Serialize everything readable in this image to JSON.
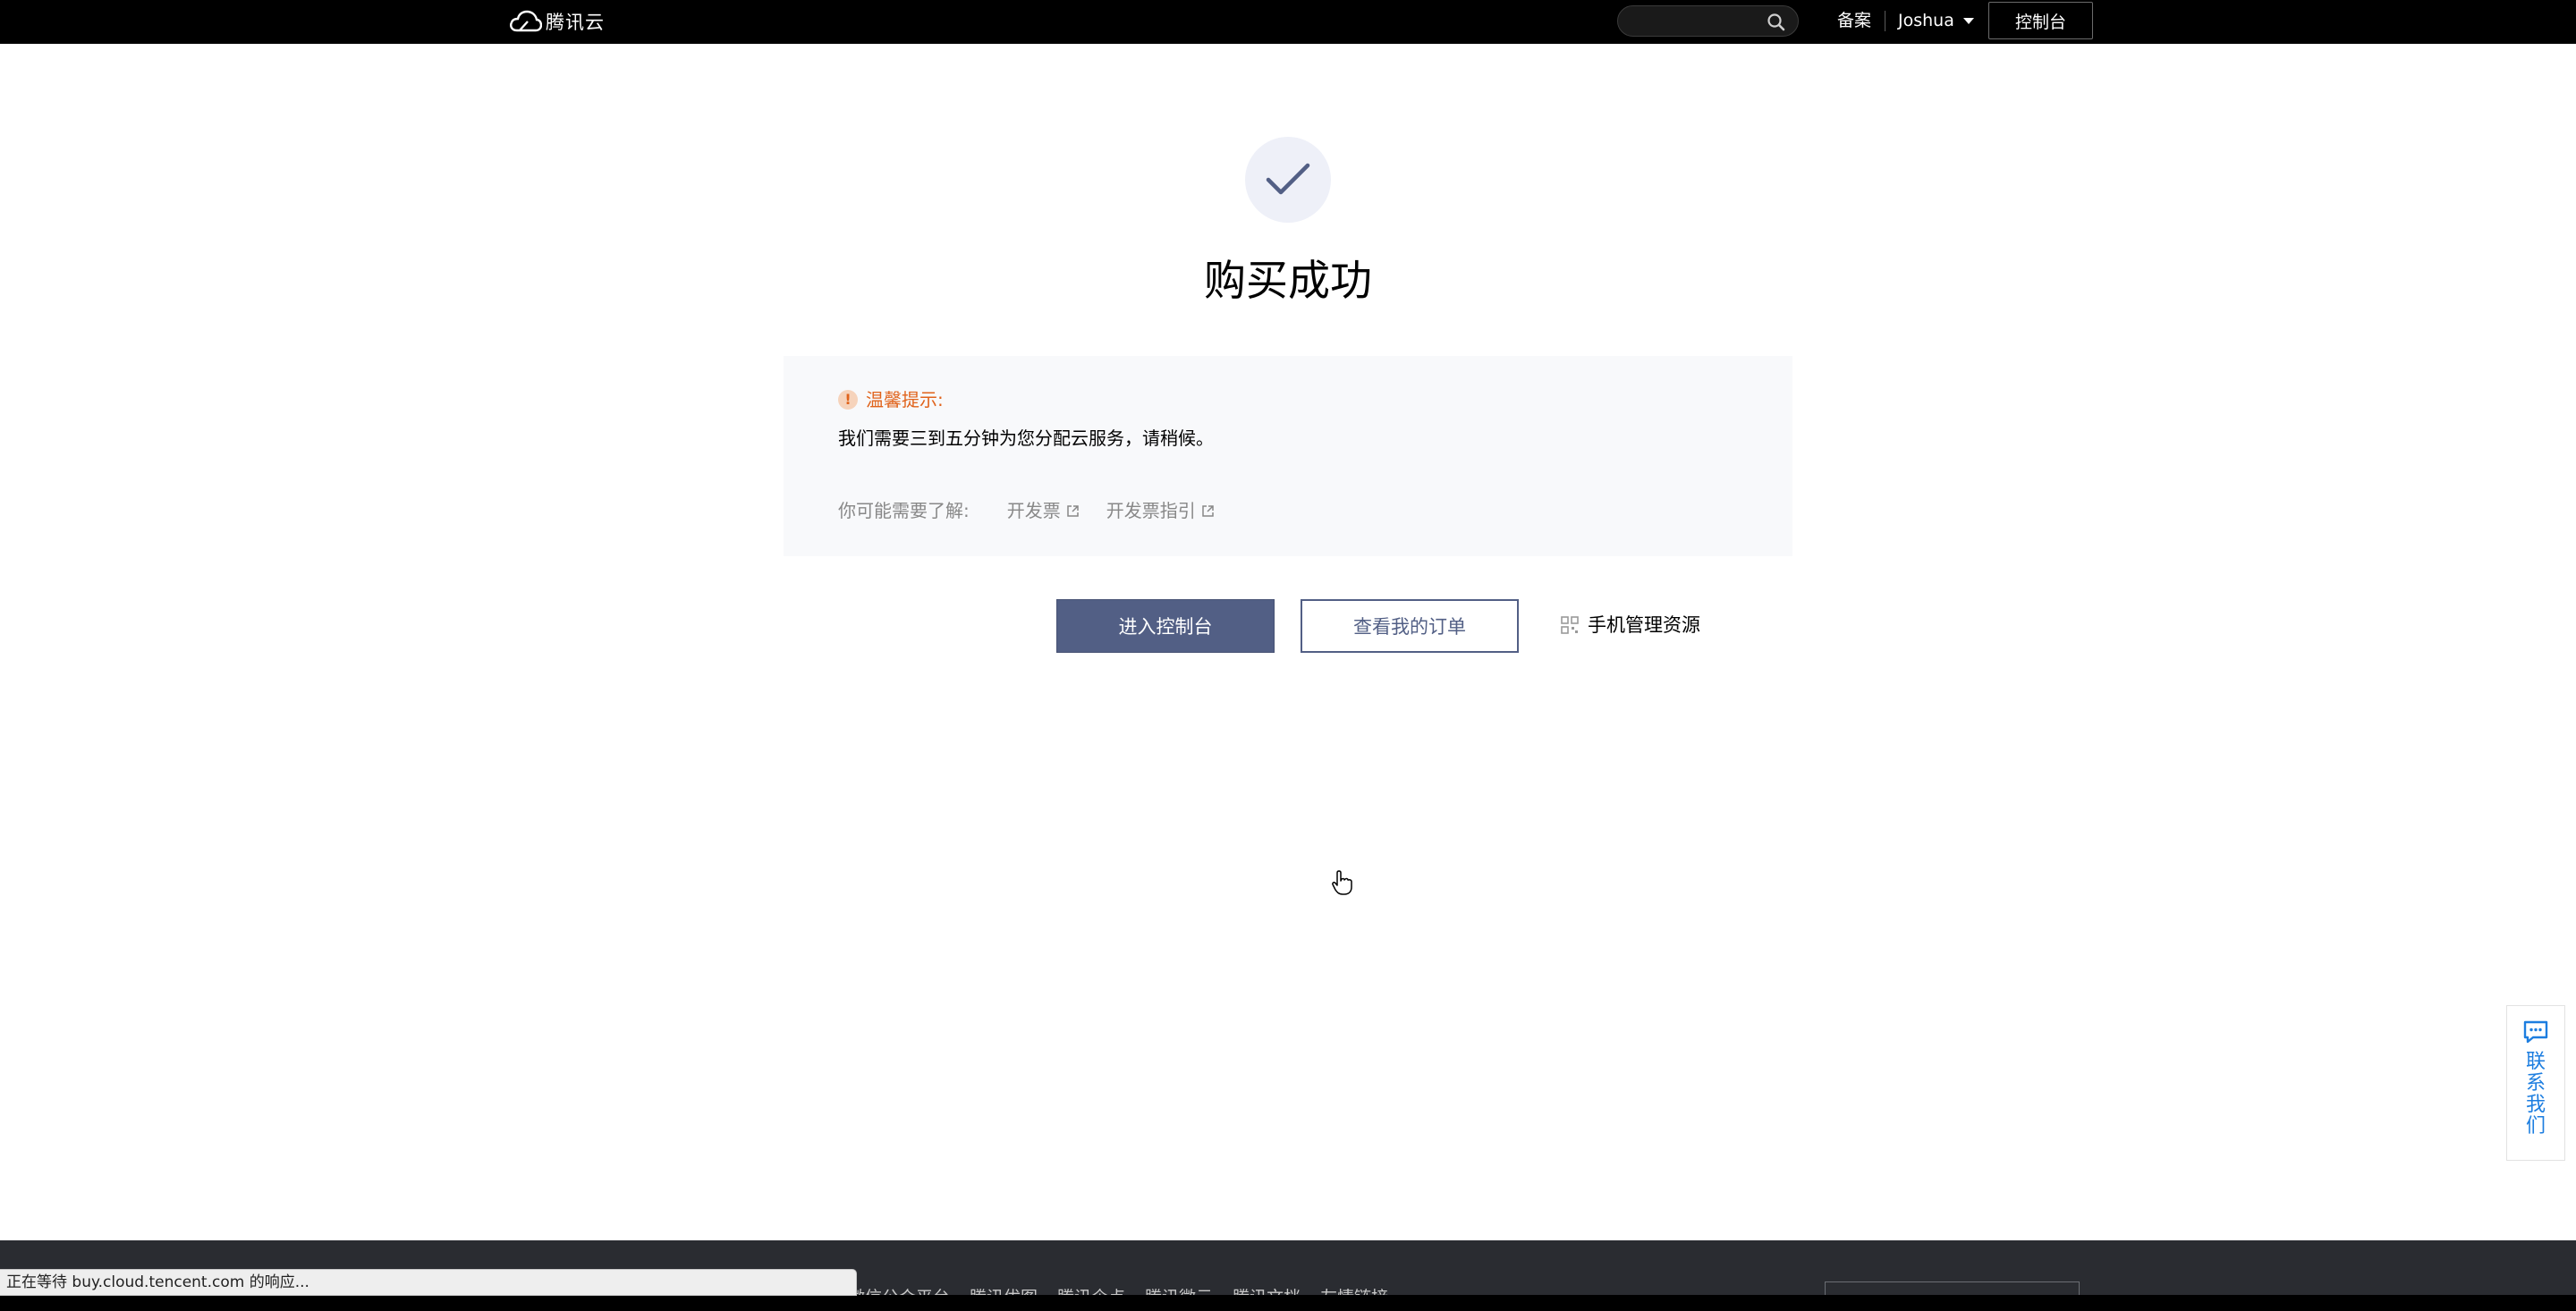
{
  "header": {
    "logo_text": "腾讯云",
    "search_placeholder": "",
    "beian_label": "备案",
    "user_name": "Joshua",
    "console_label": "控制台"
  },
  "main": {
    "title": "购买成功",
    "tip": {
      "heading": "温馨提示:",
      "body": "我们需要三到五分钟为您分配云服务，请稍候。",
      "learn_label": "你可能需要了解:",
      "links": [
        "开发票",
        "开发票指引"
      ]
    },
    "actions": {
      "primary": "进入控制台",
      "secondary": "查看我的订单",
      "mobile": "手机管理资源"
    }
  },
  "contact": {
    "label": "联系我们"
  },
  "footer": {
    "links": [
      "微信公众平台",
      "腾讯优图",
      "腾讯企点",
      "腾讯微云",
      "腾讯文档",
      "友情链接"
    ]
  },
  "status_bar": {
    "text": "正在等待 buy.cloud.tencent.com 的响应..."
  },
  "colors": {
    "primary": "#525f85",
    "warning": "#e0631b",
    "link_blue": "#1d7ee0"
  },
  "icons": [
    "cloud-logo-icon",
    "search-icon",
    "chevron-down-icon",
    "check-icon",
    "warning-icon",
    "external-link-icon",
    "qr-code-icon",
    "chat-icon",
    "hand-cursor-icon"
  ]
}
